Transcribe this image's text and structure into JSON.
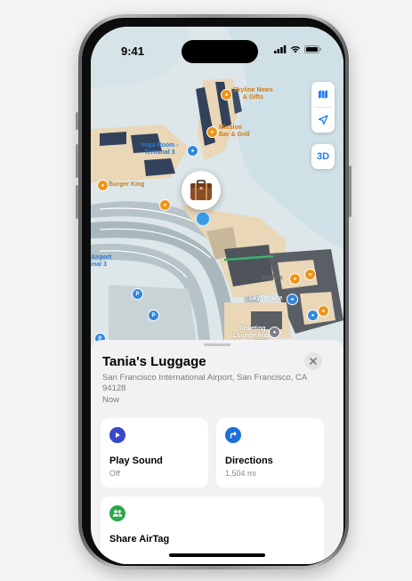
{
  "status_bar": {
    "time": "9:41"
  },
  "map": {
    "controls": {
      "three_d_label": "3D",
      "map_icon": "map-icon",
      "location_icon": "location-arrow-icon"
    },
    "labels": {
      "skyline_news": "Skyline News\n& Gifts",
      "mission_bar": "Mission\nBar & Grill",
      "yoga_room": "Yoga Room -\nTerminal 3",
      "burger_king": "Burger King",
      "airport_terminal": "Airport\ninal 3",
      "kiehls": "Kiehl's",
      "skyterrace": "SkyTerrace",
      "ticketing": "Ticketing\nLounge Area"
    },
    "pin_icon": "luggage-icon"
  },
  "sheet": {
    "title": "Tania's Luggage",
    "address": "San Francisco International Airport, San Francisco, CA  94128",
    "timestamp": "Now",
    "actions": {
      "play_sound": {
        "label": "Play Sound",
        "sub": "Off",
        "icon": "play-icon",
        "color": "#3a47c9"
      },
      "directions": {
        "label": "Directions",
        "sub": "1,504 mi",
        "icon": "turn-arrow-icon",
        "color": "#1b6fd9"
      },
      "share": {
        "label": "Share AirTag",
        "icon": "people-icon",
        "color": "#2ba84a"
      }
    }
  }
}
